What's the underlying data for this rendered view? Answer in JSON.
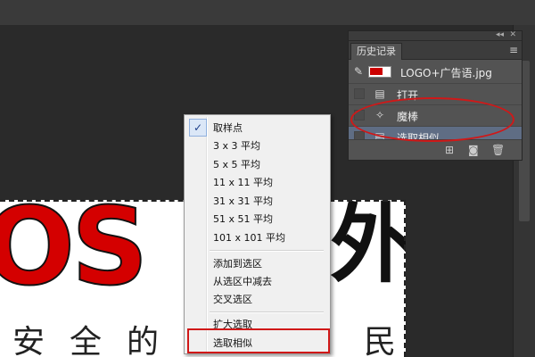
{
  "history_panel": {
    "tab_label": "历史记录",
    "snapshot_label": "LOGO+广告语.jpg",
    "items": [
      {
        "label": "打开",
        "icon": "document-icon"
      },
      {
        "label": "魔棒",
        "icon": "magic-wand-icon"
      },
      {
        "label": "选取相似",
        "icon": "document-icon",
        "active": true
      }
    ],
    "footer_icons": [
      "new-document-from-state-icon",
      "camera-snapshot-icon",
      "trash-icon"
    ]
  },
  "context_menu": {
    "items": [
      {
        "label": "取样点",
        "checked": true
      },
      {
        "label": "3 x 3 平均"
      },
      {
        "label": "5 x 5 平均"
      },
      {
        "label": "11 x 11 平均"
      },
      {
        "label": "31 x 31 平均"
      },
      {
        "label": "51 x 51 平均"
      },
      {
        "label": "101 x 101 平均"
      },
      {
        "label": "添加到选区"
      },
      {
        "label": "从选区中减去"
      },
      {
        "label": "交叉选区"
      },
      {
        "label": "扩大选取"
      },
      {
        "label": "选取相似",
        "highlighted": true
      }
    ]
  },
  "document": {
    "logo_text": "OS",
    "big_char": "外",
    "tagline_chars": "安全的",
    "tagline_end": "民"
  },
  "colors": {
    "accent_red": "#d01818",
    "logo_red": "#d40000",
    "active_row": "#5f6d84"
  }
}
